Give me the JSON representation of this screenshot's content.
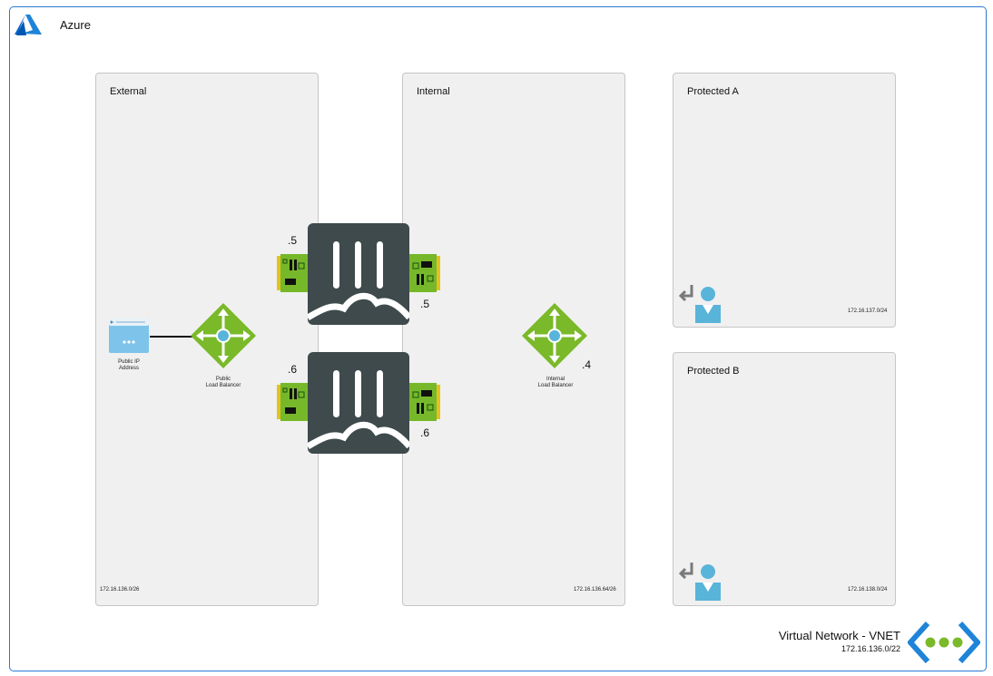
{
  "azure": {
    "label": "Azure",
    "logo_icon": "azure-logo-icon"
  },
  "subnets": {
    "external": {
      "title": "External",
      "cidr": "172.16.136.0/26"
    },
    "internal": {
      "title": "Internal",
      "cidr": "172.16.136.64/26"
    },
    "protected_a": {
      "title": "Protected A",
      "cidr": "172.16.137.0/24"
    },
    "protected_b": {
      "title": "Protected B",
      "cidr": "172.16.138.0/24"
    }
  },
  "nodes": {
    "public_ip": {
      "line1": "Public IP",
      "line2": "Address"
    },
    "public_lb": {
      "line1": "Public",
      "line2": "Load Balancer"
    },
    "internal_lb": {
      "line1": "Internal",
      "line2": "Load Balancer",
      "ip": ".4"
    },
    "fw1": {
      "external_ip": ".5",
      "internal_ip": ".5"
    },
    "fw2": {
      "external_ip": ".6",
      "internal_ip": ".6"
    }
  },
  "vnet": {
    "title": "Virtual Network - VNET",
    "cidr": "172.16.136.0/22"
  },
  "colors": {
    "frame": "#2b7bd4",
    "lb_green": "#7ab929",
    "firewall": "#3e4a4c",
    "nic_green": "#76b82a",
    "azure_blue": "#0072c6"
  }
}
